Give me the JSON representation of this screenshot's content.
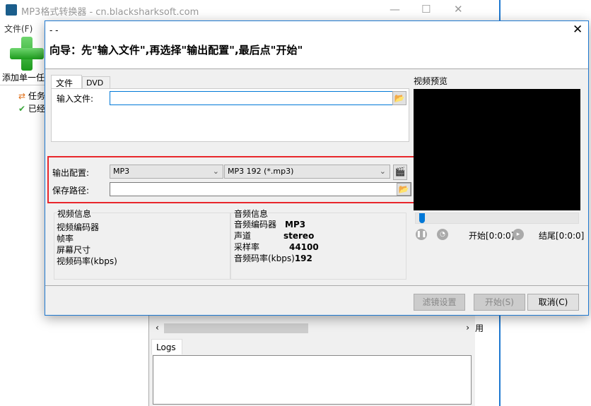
{
  "app": {
    "title": "MP3格式转换器 - cn.blacksharksoft.com",
    "menu_file": "文件(F)",
    "add_label": "添加单一任",
    "tree": [
      "任务",
      "已经"
    ],
    "side_text": "用",
    "logs_tab": "Logs"
  },
  "dialog": {
    "title": "- -",
    "guide": "向导：先\"输入文件\",再选择\"输出配置\",最后点\"开始\"",
    "tabs": [
      "文件",
      "DVD"
    ],
    "input_label": "输入文件:",
    "input_value": "",
    "output_label": "输出配置:",
    "format": "MP3",
    "profile": "MP3 192 (*.mp3)",
    "save_label": "保存路径:",
    "save_value": "",
    "video_info": {
      "title": "视频信息",
      "rows": [
        "视频编码器",
        "帧率",
        "屏幕尺寸",
        "视频码率(kbps)"
      ]
    },
    "audio_info": {
      "title": "音频信息",
      "rows": [
        {
          "k": "音频编码器",
          "v": "MP3"
        },
        {
          "k": "声道",
          "v": "stereo"
        },
        {
          "k": "采样率",
          "v": "44100"
        },
        {
          "k": "音频码率(kbps)",
          "v": "192"
        }
      ]
    },
    "preview": {
      "title": "视频预览",
      "start": "开始[0:0:0]",
      "end": "结尾[0:0:0]",
      "progress": 0
    },
    "buttons": {
      "filter": "滤镜设置",
      "start": "开始(S)",
      "cancel": "取消(C)"
    }
  },
  "colors": {
    "highlight": "#e8262c",
    "accent": "#0078d7"
  }
}
